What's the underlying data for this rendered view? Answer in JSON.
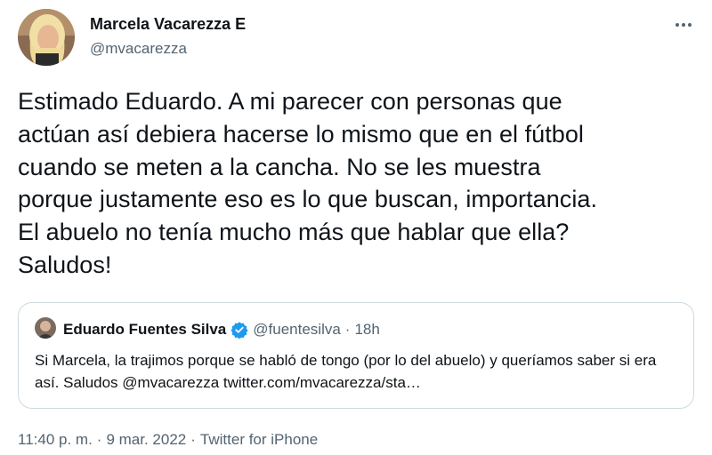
{
  "author": {
    "name": "Marcela Vacarezza E",
    "handle": "@mvacarezza"
  },
  "tweet": {
    "text": "Estimado Eduardo. A mi parecer con personas que\nactúan así debiera hacerse lo mismo que en el fútbol\ncuando se meten a la cancha. No se les muestra\nporque justamente eso es lo que buscan, importancia.\nEl abuelo no tenía mucho más que hablar que ella?\nSaludos!"
  },
  "quoted": {
    "name": "Eduardo Fuentes Silva",
    "handle": "@fuentesilva",
    "separator": "·",
    "time": "18h",
    "text": "Si Marcela, la trajimos porque se habló de tongo (por lo del abuelo)  y queríamos saber si era así. Saludos @mvacarezza twitter.com/mvacarezza/sta…"
  },
  "meta": {
    "time": "11:40 p. m.",
    "date": "9 mar. 2022",
    "source": "Twitter for iPhone",
    "separator": "·"
  },
  "colors": {
    "text": "#0f1419",
    "secondary": "#536471",
    "border": "#cfd9de",
    "verified": "#1d9bf0"
  },
  "icons": {
    "more": "more-horizontal-icon",
    "verified": "verified-badge-icon"
  }
}
